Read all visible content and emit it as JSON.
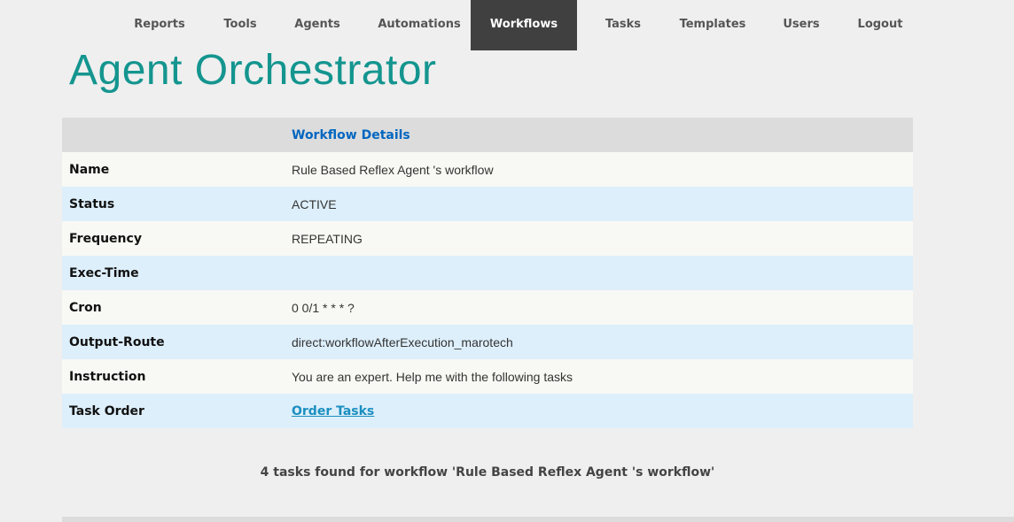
{
  "nav": {
    "items": [
      {
        "label": "Reports"
      },
      {
        "label": "Tools"
      },
      {
        "label": "Agents"
      },
      {
        "label": "Automations"
      },
      {
        "label": "Workflows",
        "active": true
      },
      {
        "label": "Tasks"
      },
      {
        "label": "Templates"
      },
      {
        "label": "Users"
      },
      {
        "label": "Logout"
      }
    ]
  },
  "app": {
    "title": "Agent Orchestrator"
  },
  "details": {
    "header": "Workflow Details",
    "rows": [
      {
        "label": "Name",
        "value": "Rule Based Reflex Agent 's workflow"
      },
      {
        "label": "Status",
        "value": "ACTIVE"
      },
      {
        "label": "Frequency",
        "value": "REPEATING"
      },
      {
        "label": "Exec-Time",
        "value": ""
      },
      {
        "label": "Cron",
        "value": "0 0/1 * * * ?"
      },
      {
        "label": "Output-Route",
        "value": "direct:workflowAfterExecution_marotech"
      },
      {
        "label": "Instruction",
        "value": "You are an expert. Help me with the following tasks"
      },
      {
        "label": "Task Order",
        "link": "Order Tasks"
      }
    ]
  },
  "tasks_found": "4 tasks found for workflow 'Rule Based Reflex Agent 's workflow'",
  "colors": {
    "accent": "#14958f",
    "active_nav_bg": "#404040",
    "link": "#0066c0",
    "row_blue": "#ddeffb",
    "row_light": "#f8f8f4"
  }
}
